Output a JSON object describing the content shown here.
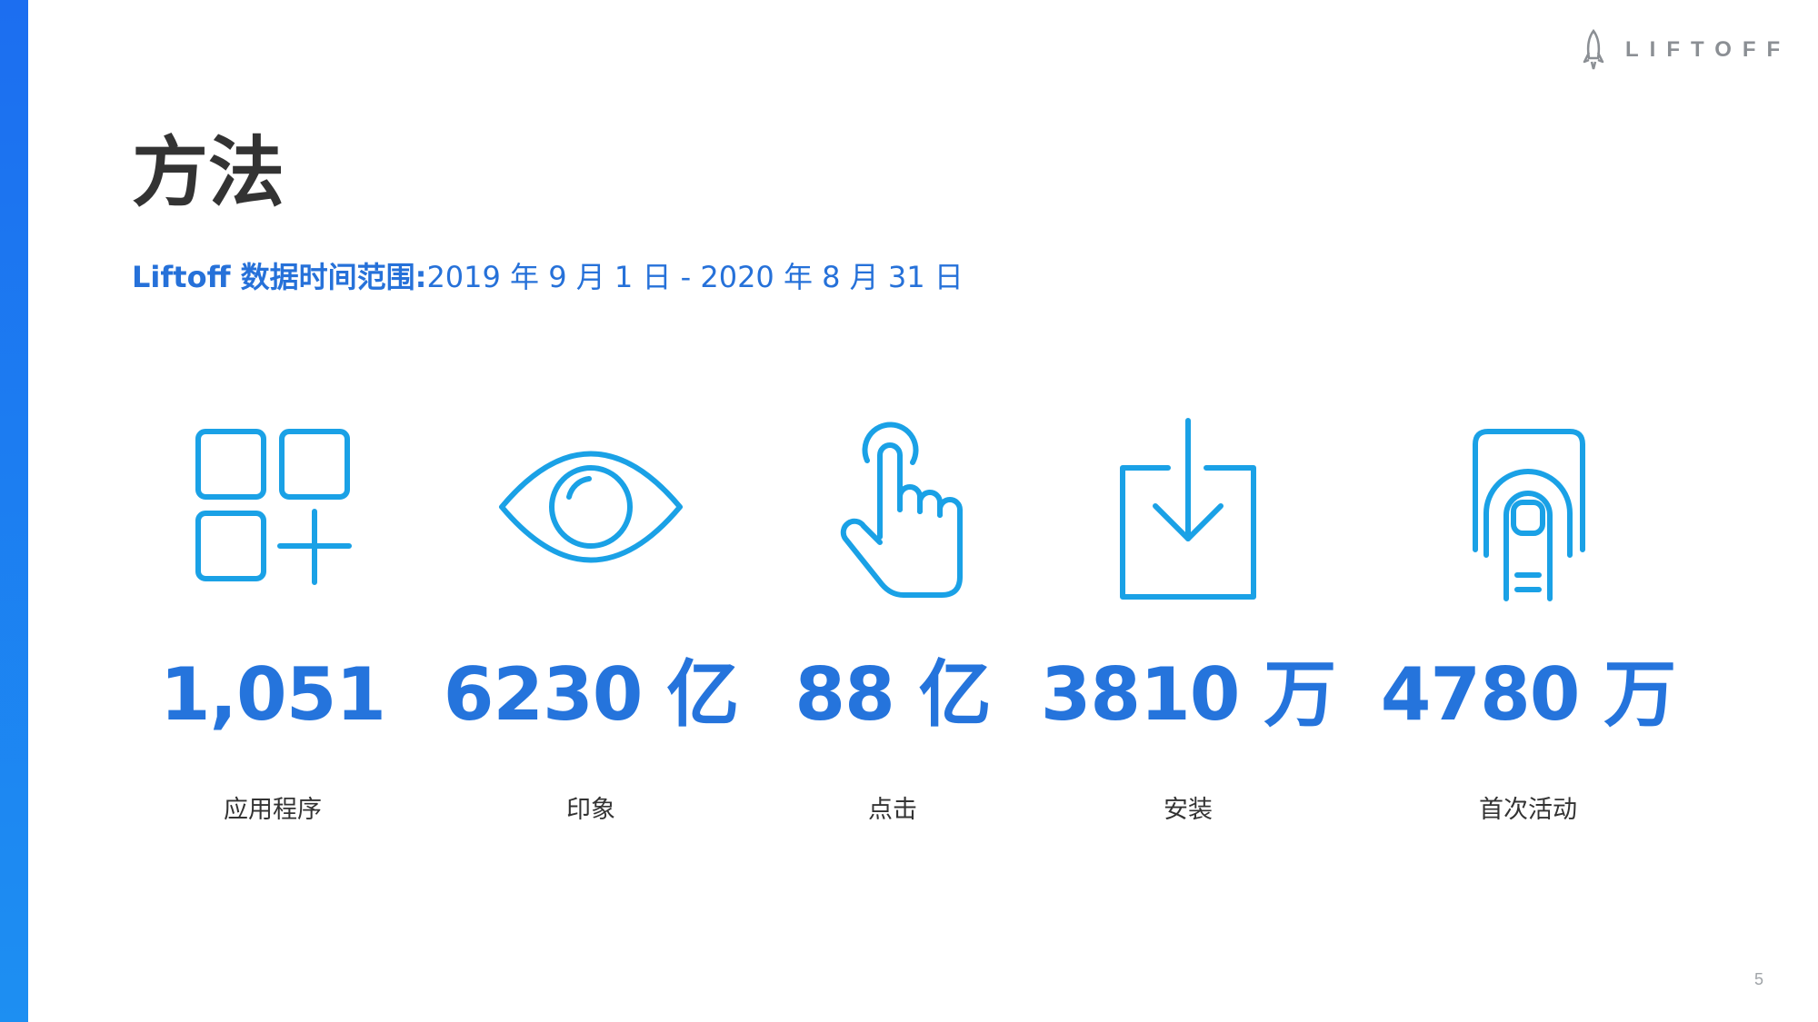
{
  "brand": {
    "logo_text": "LIFTOFF",
    "accent_color": "#2574dc",
    "bar_color": "#1c6ef0"
  },
  "title": "方法",
  "subtitle": {
    "label": "Liftoff 数据时间范围:",
    "range": "2019 年 9 月 1 日 - 2020 年 8 月 31 日"
  },
  "stats": [
    {
      "icon": "apps-grid-icon",
      "value": "1,051",
      "label": "应用程序"
    },
    {
      "icon": "eye-icon",
      "value": "6230 亿",
      "label": "印象"
    },
    {
      "icon": "tap-finger-icon",
      "value": "88 亿",
      "label": "点击"
    },
    {
      "icon": "download-icon",
      "value": "3810 万",
      "label": "安装"
    },
    {
      "icon": "fingerprint-touch-icon",
      "value": "4780 万",
      "label": "首次活动"
    }
  ],
  "page_number": "5"
}
